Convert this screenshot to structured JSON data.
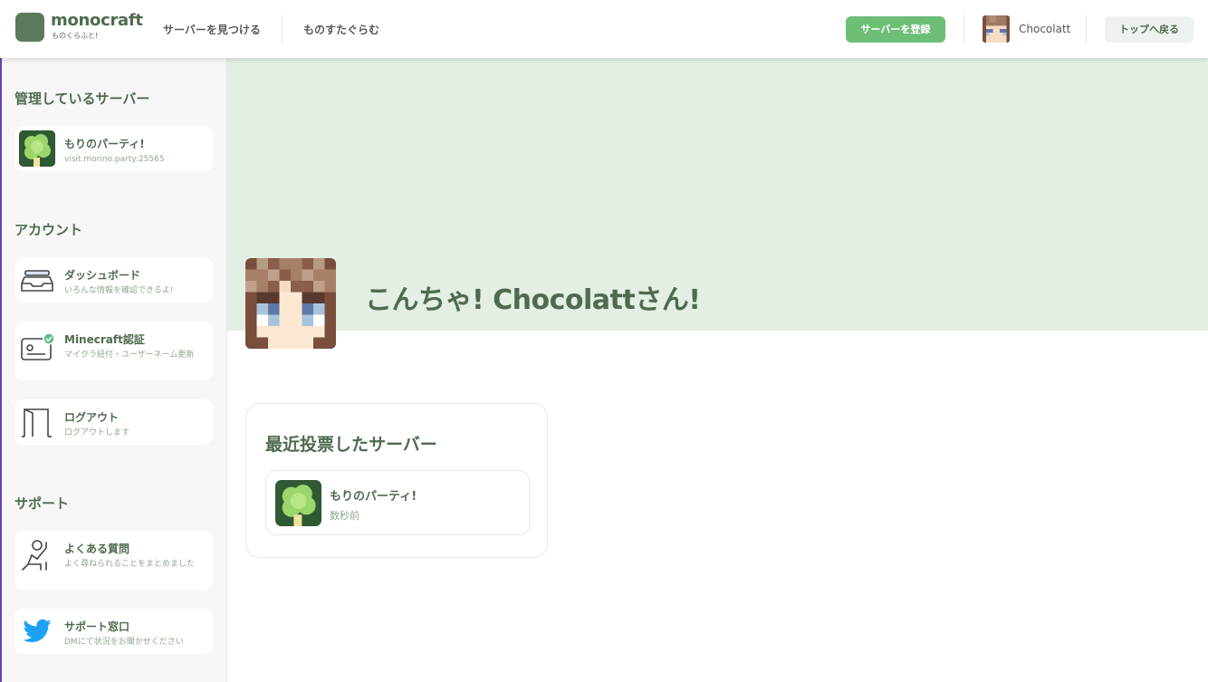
{
  "header": {
    "logo_title": "monocraft",
    "logo_subtitle": "ものくらふと!",
    "nav": [
      {
        "label": "サーバーを見つける"
      },
      {
        "label": "ものすたぐらむ"
      }
    ],
    "register_label": "サーバーを登録",
    "username": "Chocolatt",
    "back_to_top_label": "トップへ戻る"
  },
  "sidebar": {
    "managed_heading": "管理しているサーバー",
    "managed_servers": [
      {
        "name": "もりのパーティ!",
        "address": "visit.morino.party:25565",
        "icon": "tree-icon"
      }
    ],
    "account_heading": "アカウント",
    "account_items": [
      {
        "title": "ダッシュボード",
        "subtitle": "いろんな情報を確認できるよ!",
        "icon": "inbox-icon"
      },
      {
        "title": "Minecraft認証",
        "subtitle": "マイクラ紐付・ユーザーネーム更新",
        "icon": "id-card-check-icon"
      },
      {
        "title": "ログアウト",
        "subtitle": "ログアウトします",
        "icon": "door-icon"
      }
    ],
    "support_heading": "サポート",
    "support_items": [
      {
        "title": "よくある質問",
        "subtitle": "よく尋ねられることをまとめました",
        "icon": "question-person-icon"
      },
      {
        "title": "サポート窓口",
        "subtitle": "DMにて状況をお聞かせください",
        "icon": "twitter-icon"
      }
    ]
  },
  "main": {
    "greeting": "こんちゃ! Chocolattさん!",
    "recent_heading": "最近投票したサーバー",
    "recent_servers": [
      {
        "name": "もりのパーティ!",
        "time": "数秒前",
        "icon": "tree-icon"
      }
    ]
  },
  "colors": {
    "brand_green": "#5b7a5b",
    "text_green": "#4f6b4f",
    "accent_green": "#6cbf75",
    "banner_bg": "#e3efe3",
    "twitter_blue": "#1da1f2"
  }
}
